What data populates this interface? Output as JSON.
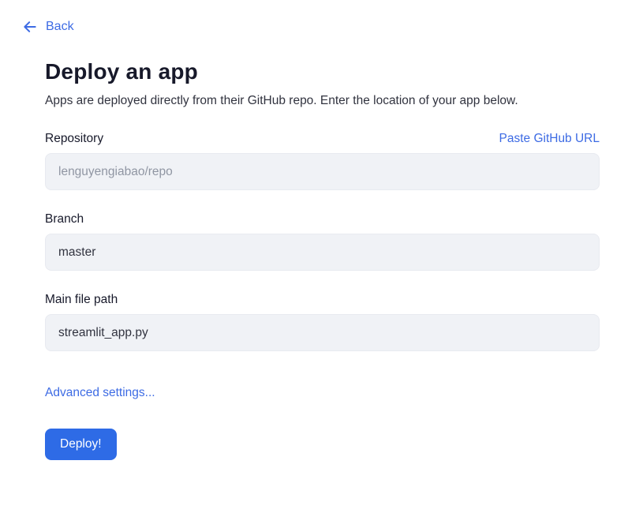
{
  "colors": {
    "link": "#3d6be4",
    "button_bg": "#2e6be6",
    "input_bg": "#f0f2f6",
    "heading_text": "#17192a",
    "body_text": "#31333f",
    "placeholder_text": "#9096a3"
  },
  "back": {
    "label": "Back"
  },
  "header": {
    "title": "Deploy an app",
    "subtitle": "Apps are deployed directly from their GitHub repo. Enter the location of your app below."
  },
  "form": {
    "repository": {
      "label": "Repository",
      "placeholder": "lenguyengiabao/repo",
      "value": "",
      "paste_link_label": "Paste GitHub URL"
    },
    "branch": {
      "label": "Branch",
      "value": "master"
    },
    "main_file": {
      "label": "Main file path",
      "value": "streamlit_app.py"
    },
    "advanced_link_label": "Advanced settings...",
    "deploy_button_label": "Deploy!"
  }
}
